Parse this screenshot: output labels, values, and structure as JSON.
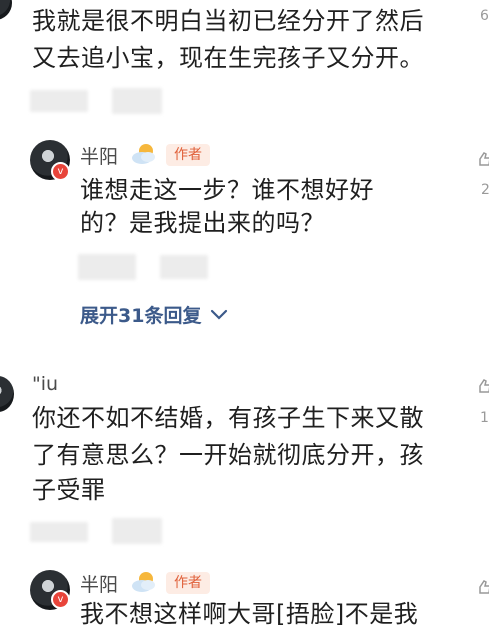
{
  "comment1": {
    "text_line1": "我就是很不明白当初已经分开了然后",
    "text_line2": "又去追小宝，现在生完孩子又分开。",
    "right_count": "6"
  },
  "reply1": {
    "name": "半阳",
    "badge": "作者",
    "text_line1": "谁想走这一步？谁不想好好",
    "text_line2": "的？是我提出来的吗？",
    "right_count": "2",
    "expand_label": "展开31条回复"
  },
  "comment2": {
    "name": "\"iu",
    "text_line1": "你还不如不结婚，有孩子生下来又散",
    "text_line2": "了有意思么？一开始就彻底分开，孩",
    "text_line3": "子受罪",
    "right_count": "1"
  },
  "reply2": {
    "name": "半阳",
    "badge": "作者",
    "text_line1": "我不想这样啊大哥[捂脸]不是我"
  }
}
